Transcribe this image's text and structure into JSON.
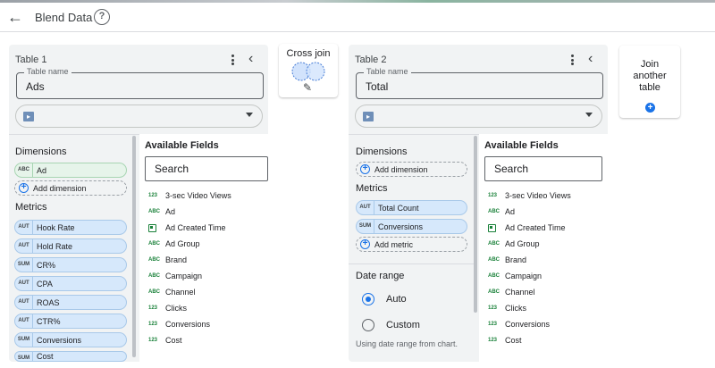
{
  "header": {
    "title": "Blend Data"
  },
  "table1": {
    "title": "Table 1",
    "name_legend": "Table name",
    "name_value": "Ads",
    "dimensions_label": "Dimensions",
    "dimensions": [
      {
        "tag": "ABC",
        "label": "Ad"
      }
    ],
    "add_dimension": "Add dimension",
    "metrics_label": "Metrics",
    "metrics": [
      {
        "tag": "AUT",
        "label": "Hook Rate"
      },
      {
        "tag": "AUT",
        "label": "Hold Rate"
      },
      {
        "tag": "SUM",
        "label": "CR%"
      },
      {
        "tag": "AUT",
        "label": "CPA"
      },
      {
        "tag": "AUT",
        "label": "ROAS"
      },
      {
        "tag": "AUT",
        "label": "CTR%"
      },
      {
        "tag": "SUM",
        "label": "Conversions"
      },
      {
        "tag": "SUM",
        "label": "Cost"
      }
    ],
    "available_fields_label": "Available Fields",
    "search_placeholder": "Search",
    "fields": [
      {
        "type": "123",
        "label": "3-sec Video Views"
      },
      {
        "type": "ABC",
        "label": "Ad"
      },
      {
        "type": "calendar",
        "label": "Ad Created Time"
      },
      {
        "type": "ABC",
        "label": "Ad Group"
      },
      {
        "type": "ABC",
        "label": "Brand"
      },
      {
        "type": "ABC",
        "label": "Campaign"
      },
      {
        "type": "ABC",
        "label": "Channel"
      },
      {
        "type": "123",
        "label": "Clicks"
      },
      {
        "type": "123",
        "label": "Conversions"
      },
      {
        "type": "123",
        "label": "Cost"
      }
    ]
  },
  "join": {
    "label": "Cross join"
  },
  "table2": {
    "title": "Table 2",
    "name_legend": "Table name",
    "name_value": "Total",
    "dimensions_label": "Dimensions",
    "add_dimension": "Add dimension",
    "metrics_label": "Metrics",
    "metrics": [
      {
        "tag": "AUT",
        "label": "Total Count"
      },
      {
        "tag": "SUM",
        "label": "Conversions"
      }
    ],
    "add_metric": "Add metric",
    "date_range_label": "Date range",
    "date_options": [
      "Auto",
      "Custom"
    ],
    "date_hint": "Using date range from chart.",
    "available_fields_label": "Available Fields",
    "search_placeholder": "Search",
    "fields": [
      {
        "type": "123",
        "label": "3-sec Video Views"
      },
      {
        "type": "ABC",
        "label": "Ad"
      },
      {
        "type": "calendar",
        "label": "Ad Created Time"
      },
      {
        "type": "ABC",
        "label": "Ad Group"
      },
      {
        "type": "ABC",
        "label": "Brand"
      },
      {
        "type": "ABC",
        "label": "Campaign"
      },
      {
        "type": "ABC",
        "label": "Channel"
      },
      {
        "type": "123",
        "label": "Clicks"
      },
      {
        "type": "123",
        "label": "Conversions"
      },
      {
        "type": "123",
        "label": "Cost"
      }
    ]
  },
  "join_another": {
    "line1": "Join",
    "line2": "another",
    "line3": "table"
  },
  "colors": {
    "accent": "#1a73e8",
    "metric_chip": "#d6e8fb",
    "dimension_chip": "#e6f4ea",
    "field_type": "#188038"
  }
}
